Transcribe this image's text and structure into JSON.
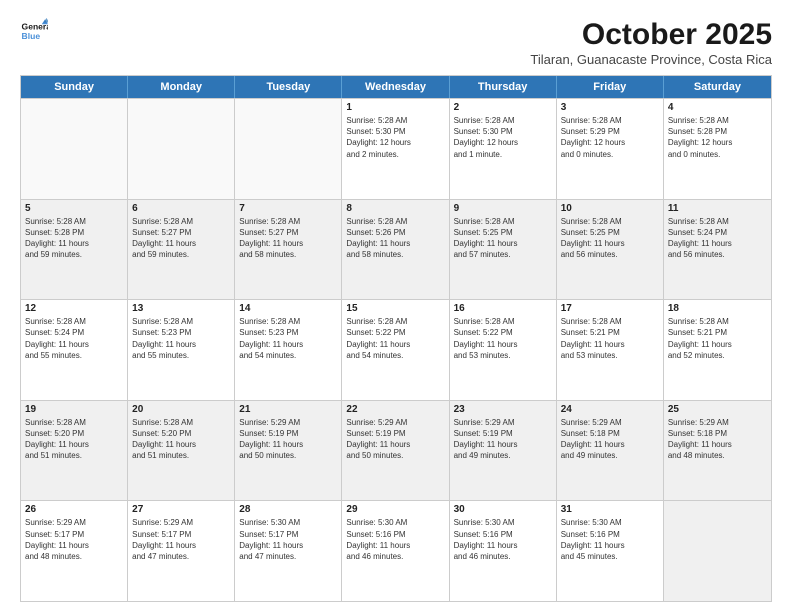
{
  "logo": {
    "line1": "General",
    "line2": "Blue"
  },
  "title": "October 2025",
  "subtitle": "Tilaran, Guanacaste Province, Costa Rica",
  "days_header": [
    "Sunday",
    "Monday",
    "Tuesday",
    "Wednesday",
    "Thursday",
    "Friday",
    "Saturday"
  ],
  "weeks": [
    [
      {
        "day": "",
        "info": ""
      },
      {
        "day": "",
        "info": ""
      },
      {
        "day": "",
        "info": ""
      },
      {
        "day": "1",
        "info": "Sunrise: 5:28 AM\nSunset: 5:30 PM\nDaylight: 12 hours\nand 2 minutes."
      },
      {
        "day": "2",
        "info": "Sunrise: 5:28 AM\nSunset: 5:30 PM\nDaylight: 12 hours\nand 1 minute."
      },
      {
        "day": "3",
        "info": "Sunrise: 5:28 AM\nSunset: 5:29 PM\nDaylight: 12 hours\nand 0 minutes."
      },
      {
        "day": "4",
        "info": "Sunrise: 5:28 AM\nSunset: 5:28 PM\nDaylight: 12 hours\nand 0 minutes."
      }
    ],
    [
      {
        "day": "5",
        "info": "Sunrise: 5:28 AM\nSunset: 5:28 PM\nDaylight: 11 hours\nand 59 minutes."
      },
      {
        "day": "6",
        "info": "Sunrise: 5:28 AM\nSunset: 5:27 PM\nDaylight: 11 hours\nand 59 minutes."
      },
      {
        "day": "7",
        "info": "Sunrise: 5:28 AM\nSunset: 5:27 PM\nDaylight: 11 hours\nand 58 minutes."
      },
      {
        "day": "8",
        "info": "Sunrise: 5:28 AM\nSunset: 5:26 PM\nDaylight: 11 hours\nand 58 minutes."
      },
      {
        "day": "9",
        "info": "Sunrise: 5:28 AM\nSunset: 5:25 PM\nDaylight: 11 hours\nand 57 minutes."
      },
      {
        "day": "10",
        "info": "Sunrise: 5:28 AM\nSunset: 5:25 PM\nDaylight: 11 hours\nand 56 minutes."
      },
      {
        "day": "11",
        "info": "Sunrise: 5:28 AM\nSunset: 5:24 PM\nDaylight: 11 hours\nand 56 minutes."
      }
    ],
    [
      {
        "day": "12",
        "info": "Sunrise: 5:28 AM\nSunset: 5:24 PM\nDaylight: 11 hours\nand 55 minutes."
      },
      {
        "day": "13",
        "info": "Sunrise: 5:28 AM\nSunset: 5:23 PM\nDaylight: 11 hours\nand 55 minutes."
      },
      {
        "day": "14",
        "info": "Sunrise: 5:28 AM\nSunset: 5:23 PM\nDaylight: 11 hours\nand 54 minutes."
      },
      {
        "day": "15",
        "info": "Sunrise: 5:28 AM\nSunset: 5:22 PM\nDaylight: 11 hours\nand 54 minutes."
      },
      {
        "day": "16",
        "info": "Sunrise: 5:28 AM\nSunset: 5:22 PM\nDaylight: 11 hours\nand 53 minutes."
      },
      {
        "day": "17",
        "info": "Sunrise: 5:28 AM\nSunset: 5:21 PM\nDaylight: 11 hours\nand 53 minutes."
      },
      {
        "day": "18",
        "info": "Sunrise: 5:28 AM\nSunset: 5:21 PM\nDaylight: 11 hours\nand 52 minutes."
      }
    ],
    [
      {
        "day": "19",
        "info": "Sunrise: 5:28 AM\nSunset: 5:20 PM\nDaylight: 11 hours\nand 51 minutes."
      },
      {
        "day": "20",
        "info": "Sunrise: 5:28 AM\nSunset: 5:20 PM\nDaylight: 11 hours\nand 51 minutes."
      },
      {
        "day": "21",
        "info": "Sunrise: 5:29 AM\nSunset: 5:19 PM\nDaylight: 11 hours\nand 50 minutes."
      },
      {
        "day": "22",
        "info": "Sunrise: 5:29 AM\nSunset: 5:19 PM\nDaylight: 11 hours\nand 50 minutes."
      },
      {
        "day": "23",
        "info": "Sunrise: 5:29 AM\nSunset: 5:19 PM\nDaylight: 11 hours\nand 49 minutes."
      },
      {
        "day": "24",
        "info": "Sunrise: 5:29 AM\nSunset: 5:18 PM\nDaylight: 11 hours\nand 49 minutes."
      },
      {
        "day": "25",
        "info": "Sunrise: 5:29 AM\nSunset: 5:18 PM\nDaylight: 11 hours\nand 48 minutes."
      }
    ],
    [
      {
        "day": "26",
        "info": "Sunrise: 5:29 AM\nSunset: 5:17 PM\nDaylight: 11 hours\nand 48 minutes."
      },
      {
        "day": "27",
        "info": "Sunrise: 5:29 AM\nSunset: 5:17 PM\nDaylight: 11 hours\nand 47 minutes."
      },
      {
        "day": "28",
        "info": "Sunrise: 5:30 AM\nSunset: 5:17 PM\nDaylight: 11 hours\nand 47 minutes."
      },
      {
        "day": "29",
        "info": "Sunrise: 5:30 AM\nSunset: 5:16 PM\nDaylight: 11 hours\nand 46 minutes."
      },
      {
        "day": "30",
        "info": "Sunrise: 5:30 AM\nSunset: 5:16 PM\nDaylight: 11 hours\nand 46 minutes."
      },
      {
        "day": "31",
        "info": "Sunrise: 5:30 AM\nSunset: 5:16 PM\nDaylight: 11 hours\nand 45 minutes."
      },
      {
        "day": "",
        "info": ""
      }
    ]
  ]
}
